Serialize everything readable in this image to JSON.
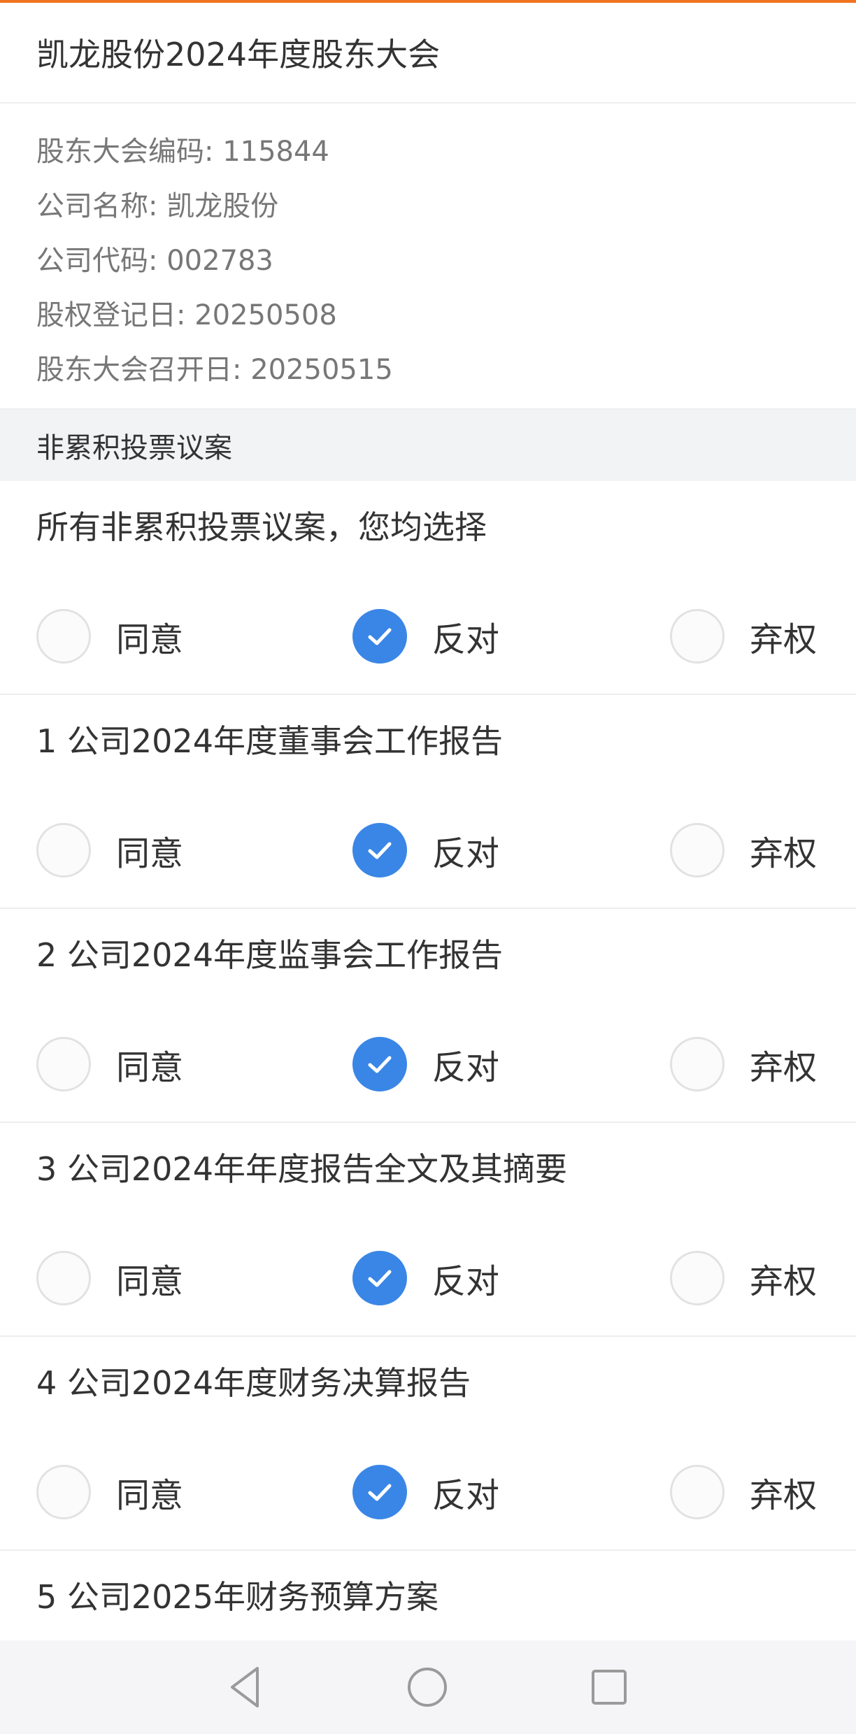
{
  "header": {
    "title": "凯龙股份2024年度股东大会"
  },
  "info": {
    "meeting_code": "股东大会编码: 115844",
    "company_name": "公司名称: 凯龙股份",
    "company_code": "公司代码: 002783",
    "record_date": "股权登记日: 20250508",
    "meeting_date": "股东大会召开日: 20250515"
  },
  "section": {
    "title": "非累积投票议案"
  },
  "options": {
    "agree": "同意",
    "oppose": "反对",
    "abstain": "弃权"
  },
  "items": [
    {
      "title": "所有非累积投票议案，您均选择",
      "selected": "oppose"
    },
    {
      "title": "1 公司2024年度董事会工作报告",
      "selected": "oppose"
    },
    {
      "title": "2 公司2024年度监事会工作报告",
      "selected": "oppose"
    },
    {
      "title": "3 公司2024年年度报告全文及其摘要",
      "selected": "oppose"
    },
    {
      "title": "4 公司2024年度财务决算报告",
      "selected": "oppose"
    },
    {
      "title": "5 公司2025年财务预算方案"
    }
  ],
  "colors": {
    "accent": "#f0731e",
    "checked": "#3a86e6"
  },
  "nav": {
    "back_icon": "triangle-back-icon",
    "home_icon": "circle-home-icon",
    "recent_icon": "square-recent-icon"
  }
}
